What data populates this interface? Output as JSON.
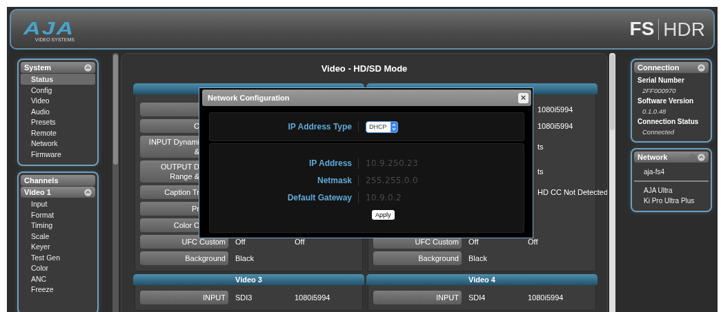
{
  "header": {
    "logo_text": "AJA",
    "logo_subtitle": "VIDEO SYSTEMS",
    "product_primary": "FS",
    "product_secondary": "HDR"
  },
  "left_sidebar": {
    "system": {
      "title": "System",
      "expanded": true,
      "items": [
        {
          "label": "Status",
          "selected": true
        },
        {
          "label": "Config",
          "selected": false
        },
        {
          "label": "Video",
          "selected": false
        },
        {
          "label": "Audio",
          "selected": false
        },
        {
          "label": "Presets",
          "selected": false
        },
        {
          "label": "Remote",
          "selected": false
        },
        {
          "label": "Network",
          "selected": false
        },
        {
          "label": "Firmware",
          "selected": false
        }
      ]
    },
    "channels": {
      "title": "Channels",
      "group": {
        "title": "Video 1",
        "expanded": true,
        "items": [
          {
            "label": "Input",
            "selected": false
          },
          {
            "label": "Format",
            "selected": false
          },
          {
            "label": "Timing",
            "selected": false
          },
          {
            "label": "Scale",
            "selected": false
          },
          {
            "label": "Keyer",
            "selected": false
          },
          {
            "label": "Test Gen",
            "selected": false
          },
          {
            "label": "Color",
            "selected": false
          },
          {
            "label": "ANC",
            "selected": false
          },
          {
            "label": "Freeze",
            "selected": false
          }
        ]
      }
    }
  },
  "main": {
    "title": "Video - HD/SD Mode",
    "top_sections": [
      {
        "partial_rows": [
          {
            "tall": false
          },
          {
            "tall": false,
            "label": "C"
          },
          {
            "tall": true,
            "label": "INPUT Dynami\n&"
          },
          {
            "tall": true,
            "label": "OUTPUT D\nRange &"
          },
          {
            "tall": false,
            "label": "Caption Tr"
          },
          {
            "tall": false,
            "label": "Pr"
          },
          {
            "tall": false,
            "label": "Color C"
          }
        ],
        "rows": [
          {
            "label": "UFC Custom",
            "values": [
              "Off",
              "Off"
            ]
          },
          {
            "label": "Background",
            "values": [
              "Black"
            ]
          }
        ]
      },
      {
        "partial_rows": [
          {
            "tall": false,
            "value": "1080i5994"
          },
          {
            "tall": false,
            "value": "1080i5994"
          },
          {
            "tall": true,
            "value": "ts"
          },
          {
            "tall": true,
            "value": "ts"
          },
          {
            "tall": false,
            "value": "HD CC Not Detected"
          },
          {
            "tall": false
          },
          {
            "tall": false
          }
        ],
        "rows": [
          {
            "label": "UFC Custom",
            "values": [
              "Off",
              "Off"
            ]
          },
          {
            "label": "Background",
            "values": [
              "Black"
            ]
          }
        ]
      }
    ],
    "bottom_sections": [
      {
        "title": "Video 3",
        "rows": [
          {
            "label": "INPUT",
            "values": [
              "SDI3",
              "1080i5994"
            ]
          }
        ]
      },
      {
        "title": "Video 4",
        "rows": [
          {
            "label": "INPUT",
            "values": [
              "SDI4",
              "1080i5994"
            ]
          }
        ]
      }
    ]
  },
  "right_sidebar": {
    "connection": {
      "title": "Connection",
      "expanded": true,
      "fields": [
        {
          "label": "Serial Number",
          "value": "2FF000970"
        },
        {
          "label": "Software Version",
          "value": "0.1.0.48"
        },
        {
          "label": "Connection Status",
          "value": "Connected"
        }
      ]
    },
    "network": {
      "title": "Network",
      "expanded": true,
      "groups": [
        [
          "aja-fs4"
        ],
        [
          "AJA Ultra",
          "Ki Pro Ultra Plus"
        ]
      ]
    }
  },
  "dialog": {
    "title": "Network Configuration",
    "close": "×",
    "address_type": {
      "label": "IP Address Type",
      "value": "DHCP"
    },
    "fields": [
      {
        "label": "IP Address",
        "value": "10.9.250.23",
        "disabled": true
      },
      {
        "label": "Netmask",
        "value": "255.255.0.0",
        "disabled": true
      },
      {
        "label": "Default Gateway",
        "value": "10.9.0.2",
        "disabled": true
      }
    ],
    "apply": "Apply"
  }
}
